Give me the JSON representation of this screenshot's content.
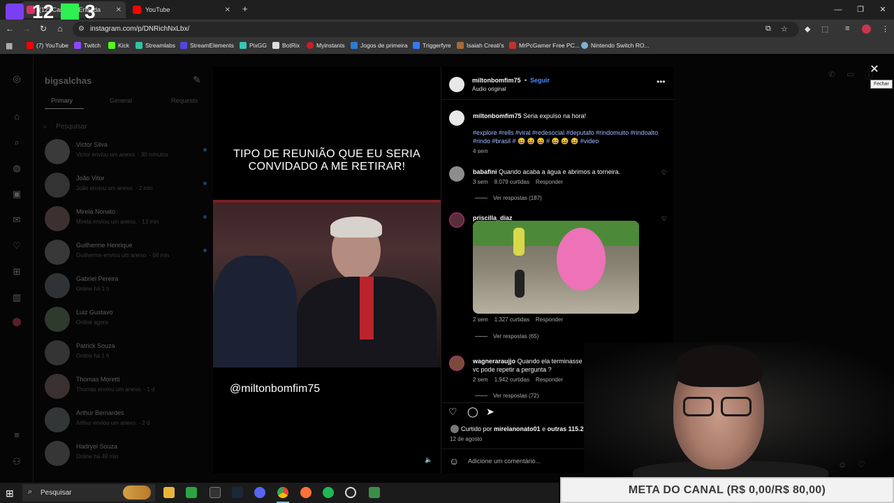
{
  "browser": {
    "tabs": [
      {
        "label": "(12) Caixa de Entrada",
        "active": true
      },
      {
        "label": "YouTube",
        "active": false
      }
    ],
    "url": "instagram.com/p/DNRichNxLbx/",
    "bookmarks": [
      "(7) YouTube",
      "Twitch",
      "Kick",
      "Streamlabs",
      "StreamElements",
      "PixGG",
      "BotRix",
      "Myinstants",
      "Jogos de primeira",
      "Triggerfyre",
      "Isaiah Creati's",
      "MrPcGamer Free PC...",
      "Nintendo Switch RO..."
    ]
  },
  "overlay": {
    "num1": "12",
    "num2": "3"
  },
  "dm": {
    "username": "bigsalchas",
    "tabs": [
      "Primary",
      "General",
      "Requests"
    ],
    "search_placeholder": "Pesquisar",
    "conversations": [
      {
        "name": "Victor Silva",
        "sub": "Victor enviou um anexo. · 30 minutos",
        "unread": true
      },
      {
        "name": "João Vitor",
        "sub": "João enviou um anexo. · 2 min",
        "unread": true
      },
      {
        "name": "Mirela Nonato",
        "sub": "Mirela enviou um anexo. · 13 min",
        "unread": true
      },
      {
        "name": "Guilherme Henrique",
        "sub": "Guilherme enviou um anexo. · 58 min",
        "unread": true
      },
      {
        "name": "Gabriel Pereira",
        "sub": "Online há 1 h",
        "unread": false
      },
      {
        "name": "Luiz Gustavo",
        "sub": "Online agora",
        "unread": false
      },
      {
        "name": "Patrick Souza",
        "sub": "Online há 1 h",
        "unread": false
      },
      {
        "name": "Thomas Moretti",
        "sub": "Thomas enviou um anexo. · 1 d",
        "unread": false
      },
      {
        "name": "Arthur Bernardes",
        "sub": "Arthur enviou um anexo. · 2 d",
        "unread": false
      },
      {
        "name": "Hadryel Souza",
        "sub": "Online há 49 min",
        "unread": false
      }
    ]
  },
  "video": {
    "caption": "TIPO DE REUNIÃO QUE EU SERIA CONVIDADO A ME RETIRAR!",
    "handle": "@miltonbomfim75"
  },
  "post": {
    "author": "miltonbomfim75",
    "follow": "Seguir",
    "audio": "Áudio original",
    "caption_text": "Seria expulso na hora!",
    "hashtags": "#explore #rells #viral #redesocial #deputafo #rindomuito #rindoalto #rindo #brasil # 😆 😆 😆 # 😆 😆 😆 #video",
    "caption_age": "4 sem",
    "comments": [
      {
        "user": "babafini",
        "text": "Quando acaba a água e abrimos a torneira.",
        "age": "3 sem",
        "likes": "8.079 curtidas",
        "reply": "Responder",
        "replies": "Ver respostas (187)"
      },
      {
        "user": "priscilla_diaz",
        "text": "",
        "age": "2 sem",
        "likes": "1.327 curtidas",
        "reply": "Responder",
        "replies": "Ver respostas (65)"
      },
      {
        "user": "wagneraraujjo",
        "text": "Quando ela terminasse eu iria falar .. não entendi vc pode repetir a pergunta ?",
        "age": "2 sem",
        "likes": "1.942 curtidas",
        "reply": "Responder",
        "replies": "Ver respostas (72)"
      }
    ],
    "liked_by_prefix": "Curtido por",
    "liked_by_user": "mirelanonato01",
    "liked_by_mid": "e",
    "liked_by_others": "outras 115.294 pessoas",
    "date": "12 de agosto",
    "add_comment": "Adicione um comentário..."
  },
  "close_tooltip": "Fechar",
  "stream": {
    "meta": "META DO CANAL (R$ 0,00/R$ 80,00)"
  },
  "taskbar": {
    "search": "Pesquisar"
  },
  "colors": {
    "accent_link": "#4a8cff",
    "hashtag": "#a0b9ff"
  }
}
